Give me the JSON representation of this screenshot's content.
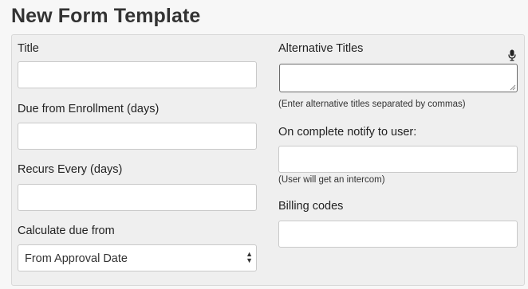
{
  "page": {
    "title": "New Form Template"
  },
  "form": {
    "title_label": "Title",
    "title_value": "",
    "due_label": "Due from Enrollment (days)",
    "due_value": "",
    "recurs_label": "Recurs Every (days)",
    "recurs_value": "",
    "calculate_label": "Calculate due from",
    "calculate_value": "From Approval Date",
    "alt_titles_label": "Alternative Titles",
    "alt_titles_value": "",
    "alt_titles_hint": "(Enter alternative titles separated by commas)",
    "notify_label": "On complete notify to user:",
    "notify_value": "",
    "notify_hint": "(User will get an intercom)",
    "billing_label": "Billing codes",
    "billing_value": ""
  },
  "icons": {
    "microphone": "microphone-icon",
    "select_arrows": "chevron-up-down-icon",
    "resize": "resize-grip-icon"
  }
}
